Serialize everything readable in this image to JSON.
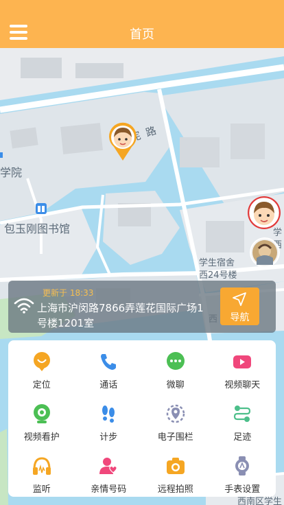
{
  "header": {
    "title": "首页",
    "menu_icon": "menu-icon"
  },
  "map": {
    "road_name": "光 宪 路",
    "labels": {
      "campus_fragment": "学院",
      "library": "包玉刚图书馆",
      "dorm": "学生宿舍",
      "dorm_building": "西24号楼",
      "right_fragment_1": "学",
      "right_fragment_2": "西",
      "right_fragment_3": "西",
      "bottom_fragment": "西南区学生"
    }
  },
  "location": {
    "update_label": "更新于",
    "update_time": "18:33",
    "address": "上海市沪闵路7866弄莲花国际广场1号楼1201室",
    "nav_label": "导航"
  },
  "functions": [
    {
      "label": "定位",
      "icon": "location-icon",
      "color": "#f5a623"
    },
    {
      "label": "通话",
      "icon": "phone-icon",
      "color": "#3b8de8"
    },
    {
      "label": "微聊",
      "icon": "chat-icon",
      "color": "#4cbf54"
    },
    {
      "label": "视频聊天",
      "icon": "video-icon",
      "color": "#f0477b"
    },
    {
      "label": "视频看护",
      "icon": "camera-icon",
      "color": "#4cbf54"
    },
    {
      "label": "计步",
      "icon": "footprint-icon",
      "color": "#3b8de8"
    },
    {
      "label": "电子围栏",
      "icon": "fence-icon",
      "color": "#8a8fb3"
    },
    {
      "label": "足迹",
      "icon": "track-icon",
      "color": "#4cbf8a"
    },
    {
      "label": "监听",
      "icon": "headphone-icon",
      "color": "#f5a623"
    },
    {
      "label": "亲情号码",
      "icon": "family-icon",
      "color": "#f0477b"
    },
    {
      "label": "远程拍照",
      "icon": "photo-icon",
      "color": "#f5a623"
    },
    {
      "label": "手表设置",
      "icon": "watch-icon",
      "color": "#8a8fb3"
    }
  ]
}
